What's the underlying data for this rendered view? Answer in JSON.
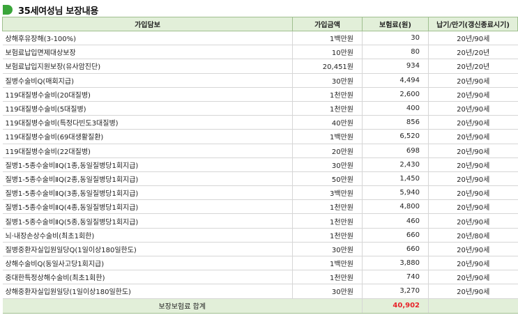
{
  "title": "35세여성님 보장내용",
  "columns": [
    "가입담보",
    "가입금액",
    "보험료(원)",
    "납기/만기(갱신종료시기)"
  ],
  "rows": [
    {
      "name": "상해후유장해(3-100%)",
      "amount": "1백만원",
      "premium": "30",
      "period": "20년/90세"
    },
    {
      "name": "보험료납입면제대상보장",
      "amount": "10만원",
      "premium": "80",
      "period": "20년/20년"
    },
    {
      "name": "보험료납입지원보장(유사암진단)",
      "amount": "20,451원",
      "premium": "934",
      "period": "20년/20년"
    },
    {
      "name": "질병수술비Q(매회지급)",
      "amount": "30만원",
      "premium": "4,494",
      "period": "20년/90세"
    },
    {
      "name": "119대질병수술비(20대질병)",
      "amount": "1천만원",
      "premium": "2,600",
      "period": "20년/90세"
    },
    {
      "name": "119대질병수술비(5대질병)",
      "amount": "1천만원",
      "premium": "400",
      "period": "20년/90세"
    },
    {
      "name": "119대질병수술비(특정다빈도3대질병)",
      "amount": "40만원",
      "premium": "856",
      "period": "20년/90세"
    },
    {
      "name": "119대질병수술비(69대생활질환)",
      "amount": "1백만원",
      "premium": "6,520",
      "period": "20년/90세"
    },
    {
      "name": "119대질병수술비(22대질병)",
      "amount": "20만원",
      "premium": "698",
      "period": "20년/90세"
    },
    {
      "name": "질병1-5종수술비ⅡQ(1종,동일질병당1회지급)",
      "amount": "30만원",
      "premium": "2,430",
      "period": "20년/90세"
    },
    {
      "name": "질병1-5종수술비ⅡQ(2종,동일질병당1회지급)",
      "amount": "50만원",
      "premium": "1,450",
      "period": "20년/90세"
    },
    {
      "name": "질병1-5종수술비ⅡQ(3종,동일질병당1회지급)",
      "amount": "3백만원",
      "premium": "5,940",
      "period": "20년/90세"
    },
    {
      "name": "질병1-5종수술비ⅡQ(4종,동일질병당1회지급)",
      "amount": "1천만원",
      "premium": "4,800",
      "period": "20년/90세"
    },
    {
      "name": "질병1-5종수술비ⅡQ(5종,동일질병당1회지급)",
      "amount": "1천만원",
      "premium": "460",
      "period": "20년/90세"
    },
    {
      "name": "뇌·내장손상수술비(최초1회한)",
      "amount": "1천만원",
      "premium": "660",
      "period": "20년/80세"
    },
    {
      "name": "질병중환자실입원일당Q(1일이상180일한도)",
      "amount": "30만원",
      "premium": "660",
      "period": "20년/90세"
    },
    {
      "name": "상해수술비Q(동일사고당1회지급)",
      "amount": "1백만원",
      "premium": "3,880",
      "period": "20년/90세"
    },
    {
      "name": "중대한특정상해수술비(최초1회한)",
      "amount": "1천만원",
      "premium": "740",
      "period": "20년/90세"
    },
    {
      "name": "상해중환자실입원일당(1일이상180일한도)",
      "amount": "30만원",
      "premium": "3,270",
      "period": "20년/90세"
    }
  ],
  "total": {
    "label": "보장보험료 합계",
    "value": "40,902"
  },
  "colors": {
    "header_bg": "#e2efd9",
    "title_mark": "#3aa53a",
    "total_value": "#e8232a"
  }
}
